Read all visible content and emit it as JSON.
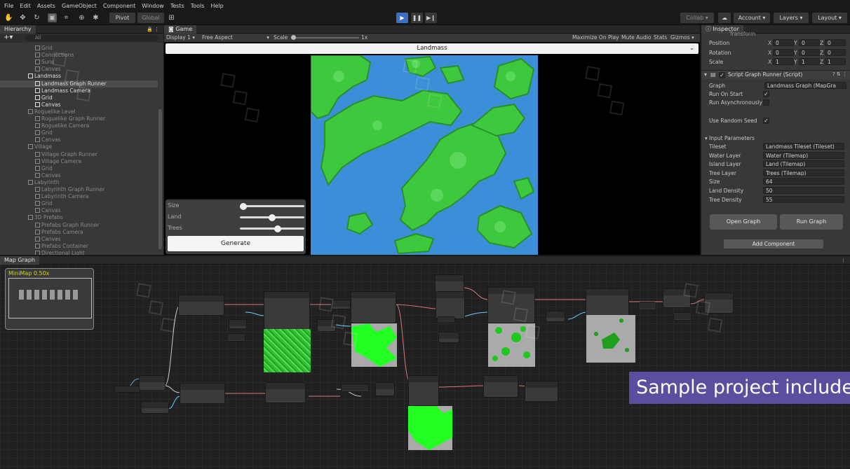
{
  "menu": [
    "File",
    "Edit",
    "Assets",
    "GameObject",
    "Component",
    "Window",
    "Tests",
    "Tools",
    "Help"
  ],
  "toolbar": {
    "pivot": "Pivot",
    "global": "Global",
    "collab": "Collab",
    "account": "Account",
    "layers": "Layers",
    "layout": "Layout"
  },
  "hierarchy": {
    "tab": "Hierarchy",
    "search_placeholder": "All",
    "rows": [
      {
        "label": "Grid",
        "indent": 2,
        "active": false
      },
      {
        "label": "Connections",
        "indent": 2,
        "active": false
      },
      {
        "label": "Suns",
        "indent": 2,
        "active": false
      },
      {
        "label": "Canvas",
        "indent": 2,
        "active": false
      },
      {
        "label": "Landmass",
        "indent": 1,
        "active": true
      },
      {
        "label": "Landmass Graph Runner",
        "indent": 2,
        "active": true,
        "selected": true
      },
      {
        "label": "Landmass Camera",
        "indent": 2,
        "active": true
      },
      {
        "label": "Grid",
        "indent": 2,
        "active": true
      },
      {
        "label": "Canvas",
        "indent": 2,
        "active": true
      },
      {
        "label": "Roguelike Level",
        "indent": 1,
        "active": false
      },
      {
        "label": "Roguelike Graph Runner",
        "indent": 2,
        "active": false
      },
      {
        "label": "Roguelike Camera",
        "indent": 2,
        "active": false
      },
      {
        "label": "Grid",
        "indent": 2,
        "active": false
      },
      {
        "label": "Canvas",
        "indent": 2,
        "active": false
      },
      {
        "label": "Village",
        "indent": 1,
        "active": false
      },
      {
        "label": "Village Graph Runner",
        "indent": 2,
        "active": false
      },
      {
        "label": "Village Camera",
        "indent": 2,
        "active": false
      },
      {
        "label": "Grid",
        "indent": 2,
        "active": false
      },
      {
        "label": "Canvas",
        "indent": 2,
        "active": false
      },
      {
        "label": "Labyrinth",
        "indent": 1,
        "active": false
      },
      {
        "label": "Labyrinth Graph Runner",
        "indent": 2,
        "active": false
      },
      {
        "label": "Labyrinth Camera",
        "indent": 2,
        "active": false
      },
      {
        "label": "Grid",
        "indent": 2,
        "active": false
      },
      {
        "label": "Canvas",
        "indent": 2,
        "active": false
      },
      {
        "label": "3D Prefabs",
        "indent": 1,
        "active": false
      },
      {
        "label": "Prefabs Graph Runner",
        "indent": 2,
        "active": false
      },
      {
        "label": "Prefabs Camera",
        "indent": 2,
        "active": false
      },
      {
        "label": "Canvas",
        "indent": 2,
        "active": false
      },
      {
        "label": "Prefabs Container",
        "indent": 2,
        "active": false
      },
      {
        "label": "Directional Light",
        "indent": 2,
        "active": false
      }
    ]
  },
  "game": {
    "tab": "Game",
    "display": "Display 1",
    "aspect": "Free Aspect",
    "scale_label": "Scale",
    "scale_value": "1x",
    "maximize": "Maximize On Play",
    "mute": "Mute Audio",
    "stats": "Stats",
    "gizmos": "Gizmos",
    "dropdown": "Landmass",
    "sliders": [
      {
        "label": "Size",
        "value": 0.0
      },
      {
        "label": "Land",
        "value": 0.5
      },
      {
        "label": "Trees",
        "value": 0.6
      }
    ],
    "generate": "Generate"
  },
  "inspector": {
    "tab": "Inspector",
    "transform": "Transform",
    "position": {
      "label": "Position",
      "x": "0",
      "y": "0",
      "z": "0"
    },
    "rotation": {
      "label": "Rotation",
      "x": "0",
      "y": "0",
      "z": "0"
    },
    "scale": {
      "label": "Scale",
      "x": "1",
      "y": "1",
      "z": "1"
    },
    "component": "Script Graph Runner (Script)",
    "graph_label": "Graph",
    "graph_value": "Landmass Graph (MapGra",
    "run_on_start": "Run On Start",
    "run_async": "Run Asynchronously",
    "use_random_seed": "Use Random Seed",
    "input_params": "Input Parameters",
    "params": [
      {
        "label": "Tileset",
        "value": "Landmass Tileset (Tileset)"
      },
      {
        "label": "Water Layer",
        "value": "Water (Tilemap)"
      },
      {
        "label": "Island Layer",
        "value": "Land (Tilemap)"
      },
      {
        "label": "Tree Layer",
        "value": "Trees (Tilemap)"
      },
      {
        "label": "Size",
        "value": "64"
      },
      {
        "label": "Land Density",
        "value": "50"
      },
      {
        "label": "Tree Density",
        "value": "55"
      }
    ],
    "open_graph": "Open Graph",
    "run_graph": "Run Graph",
    "add_component": "Add Component"
  },
  "mapgraph": {
    "tab": "Map Graph",
    "minimap": "MiniMap  0.50x",
    "banner": "Sample project included."
  },
  "colors": {
    "accent": "#4d7ed6",
    "water": "#3b8fd8",
    "land": "#3ec83e",
    "banner": "#5a4f9e"
  }
}
